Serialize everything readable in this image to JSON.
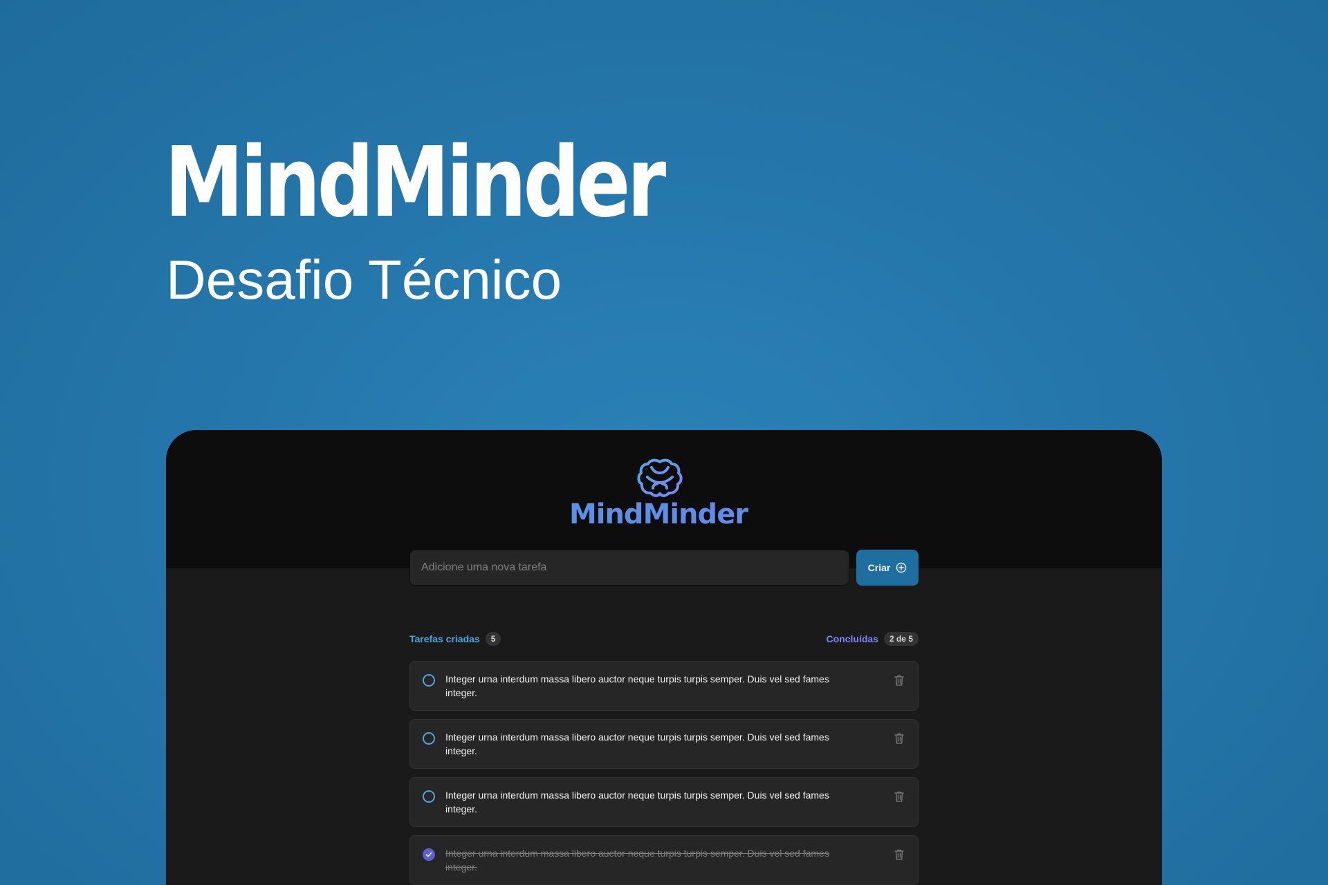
{
  "hero": {
    "title": "MindMinder",
    "subtitle": "Desafio Técnico"
  },
  "app": {
    "logo_text": "MindMinder",
    "logo_icon": "brain-icon",
    "logo_gradient": [
      "#4ea8de",
      "#8284fa"
    ],
    "new_task": {
      "placeholder": "Adicione uma nova tarefa",
      "create_label": "Criar",
      "create_icon": "plus-circle-icon"
    },
    "summary": {
      "created_label": "Tarefas criadas",
      "created_count": "5",
      "done_label": "Concluídas",
      "done_count": "2 de 5"
    },
    "tasks": [
      {
        "text": "Integer urna interdum massa libero auctor neque turpis turpis semper. Duis vel sed fames integer.",
        "done": false
      },
      {
        "text": "Integer urna interdum massa libero auctor neque turpis turpis semper. Duis vel sed fames integer.",
        "done": false
      },
      {
        "text": "Integer urna interdum massa libero auctor neque turpis turpis semper. Duis vel sed fames integer.",
        "done": false
      },
      {
        "text": "Integer urna interdum massa libero auctor neque turpis turpis semper. Duis vel sed fames integer.",
        "done": true
      }
    ],
    "colors": {
      "blue": "#4ea8de",
      "purple": "#8284fa",
      "button": "#1e6f9f",
      "check_done": "#5e60ce"
    }
  }
}
